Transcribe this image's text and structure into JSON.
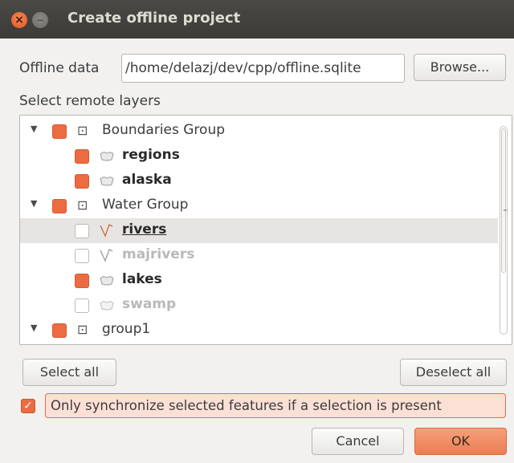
{
  "window": {
    "title": "Create offline project",
    "close_glyph": "×",
    "min_glyph": "−"
  },
  "offline_data": {
    "label": "Offline data",
    "value": "/home/delazj/dev/cpp/offline.sqlite",
    "browse_label": "Browse..."
  },
  "layers": {
    "label": "Select remote layers",
    "rows": [
      {
        "kind": "group",
        "label": "Boundaries Group",
        "checked": true,
        "expanded": true
      },
      {
        "kind": "polygon",
        "label": "regions",
        "checked": true,
        "enabled": true
      },
      {
        "kind": "polygon",
        "label": "alaska",
        "checked": true,
        "enabled": true
      },
      {
        "kind": "group",
        "label": "Water Group",
        "checked": true,
        "expanded": true
      },
      {
        "kind": "line",
        "label": "rivers",
        "checked": false,
        "enabled": true,
        "selected": true
      },
      {
        "kind": "line",
        "label": "majrivers",
        "checked": false,
        "enabled": false
      },
      {
        "kind": "polygon",
        "label": "lakes",
        "checked": true,
        "enabled": true
      },
      {
        "kind": "polygon",
        "label": "swamp",
        "checked": false,
        "enabled": false
      },
      {
        "kind": "group",
        "label": "group1",
        "checked": true,
        "expanded": true
      }
    ]
  },
  "buttons": {
    "select_all": "Select all",
    "deselect_all": "Deselect all",
    "cancel": "Cancel",
    "ok": "OK"
  },
  "sync_option": {
    "label": "Only synchronize selected features if a selection is present",
    "checked": true
  },
  "icons": {
    "expand": "▼",
    "group": "⊡",
    "check": "✓"
  },
  "colors": {
    "accent": "#ec6b41",
    "titlebar": "#3c3b37",
    "background": "#f2f1f0"
  }
}
